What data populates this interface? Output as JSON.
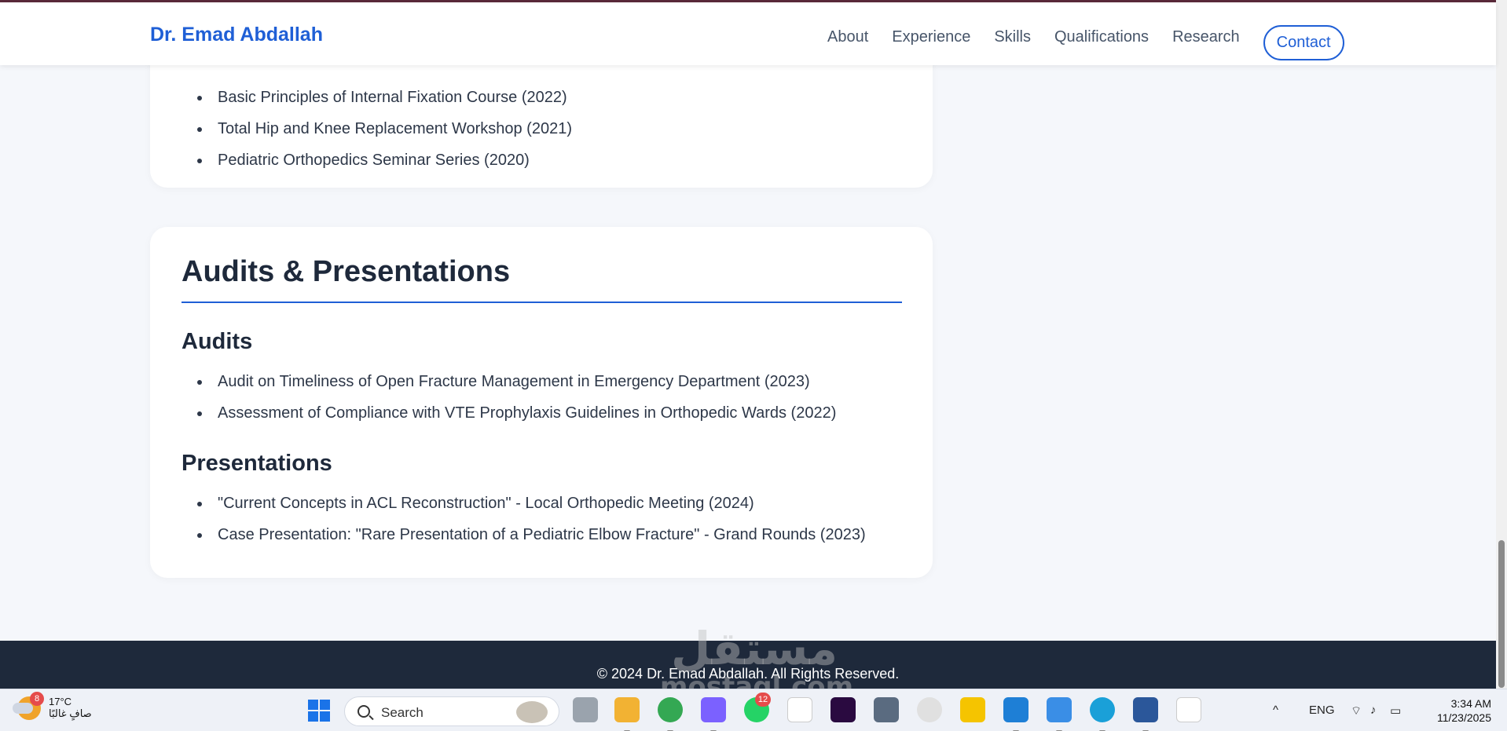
{
  "header": {
    "brand": "Dr. Emad Abdallah",
    "nav": [
      "About",
      "Experience",
      "Skills",
      "Qualifications",
      "Research"
    ],
    "contact_label": "Contact"
  },
  "courses": {
    "items": [
      "Basic Principles of Internal Fixation Course (2022)",
      "Total Hip and Knee Replacement Workshop (2021)",
      "Pediatric Orthopedics Seminar Series (2020)"
    ]
  },
  "audits_section": {
    "title": "Audits & Presentations",
    "audits_title": "Audits",
    "audits": [
      "Audit on Timeliness of Open Fracture Management in Emergency Department (2023)",
      "Assessment of Compliance with VTE Prophylaxis Guidelines in Orthopedic Wards (2022)"
    ],
    "presentations_title": "Presentations",
    "presentations": [
      "\"Current Concepts in ACL Reconstruction\" - Local Orthopedic Meeting (2024)",
      "Case Presentation: \"Rare Presentation of a Pediatric Elbow Fracture\" - Grand Rounds (2023)"
    ]
  },
  "footer": {
    "text": "© 2024 Dr. Emad Abdallah. All Rights Reserved."
  },
  "watermark": {
    "arabic": "مستقل",
    "latin": "mostaql.com"
  },
  "taskbar": {
    "weather_temp": "17°C",
    "weather_desc": "صافٍ غالبًا",
    "weather_badge": "8",
    "search_label": "Search",
    "whatsapp_badge": "12",
    "language": "ENG",
    "time": "3:34 AM",
    "date": "11/23/2025"
  },
  "colors": {
    "accent": "#1f5fd6",
    "footer_bg": "#1e293b",
    "page_bg": "#f5f7fb"
  }
}
